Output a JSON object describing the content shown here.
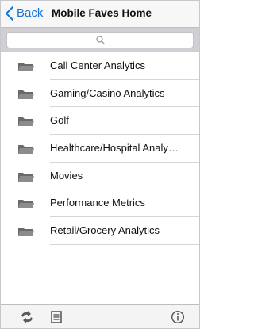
{
  "navbar": {
    "back_label": "Back",
    "title": "Mobile Faves Home"
  },
  "search": {
    "icon": "search-icon"
  },
  "folders": [
    {
      "label": "Call Center Analytics",
      "icon": "folder-icon"
    },
    {
      "label": "Gaming/Casino Analytics",
      "icon": "folder-icon"
    },
    {
      "label": "Golf",
      "icon": "folder-icon"
    },
    {
      "label": "Healthcare/Hospital Analy…",
      "icon": "folder-icon"
    },
    {
      "label": "Movies",
      "icon": "folder-icon"
    },
    {
      "label": "Performance Metrics",
      "icon": "folder-icon"
    },
    {
      "label": "Retail/Grocery Analytics",
      "icon": "folder-icon"
    }
  ],
  "toolbar": {
    "icons": [
      "refresh-icon",
      "layout-icon",
      "info-icon"
    ]
  },
  "colors": {
    "accent": "#1a73d9",
    "icon_gray": "#5a5a5a"
  }
}
